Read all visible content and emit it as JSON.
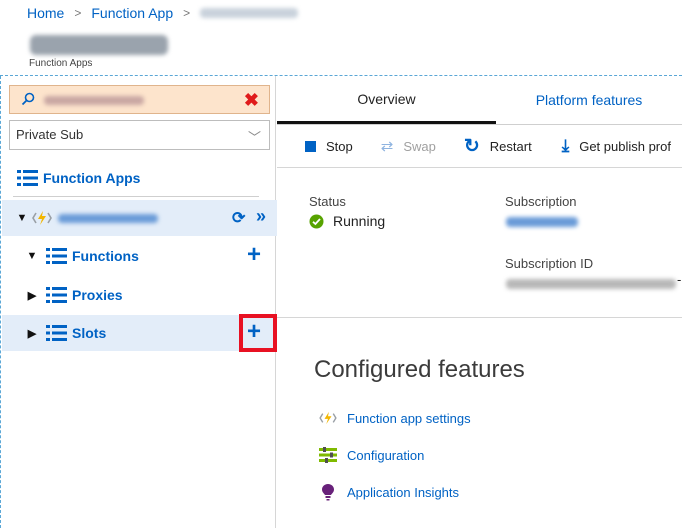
{
  "breadcrumb": {
    "items": [
      "Home",
      "Function App"
    ],
    "separator": ">"
  },
  "resource": {
    "subtitle": "Function Apps"
  },
  "left": {
    "subscription_select": {
      "value": "Private Sub"
    },
    "tree": {
      "root": "Function Apps",
      "children": [
        "Functions",
        "Proxies",
        "Slots"
      ]
    }
  },
  "tabs": [
    "Overview",
    "Platform features"
  ],
  "toolbar": {
    "stop": "Stop",
    "swap": "Swap",
    "restart": "Restart",
    "publish": "Get publish prof"
  },
  "essentials": {
    "status_label": "Status",
    "status_value": "Running",
    "subscription_label": "Subscription",
    "subscription_id_label": "Subscription ID",
    "subscription_id_suffix": "-"
  },
  "configured": {
    "title": "Configured features",
    "items": [
      "Function app settings",
      "Configuration",
      "Application Insights"
    ]
  },
  "colors": {
    "accent": "#0062c4",
    "highlight": "#e81123",
    "running": "#57a300",
    "search_bg": "#fde4cc"
  }
}
